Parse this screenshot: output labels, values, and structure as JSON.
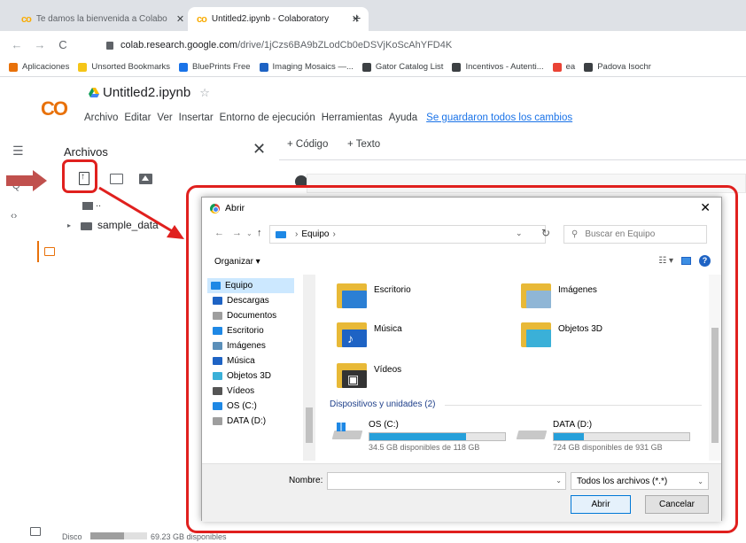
{
  "browser": {
    "tabs": [
      {
        "title": "Te damos la bienvenida a Colabo",
        "active": false
      },
      {
        "title": "Untitled2.ipynb - Colaboratory",
        "active": true
      }
    ],
    "url_host": "colab.research.google.com",
    "url_path": "/drive/1jCzs6BA9bZLodCb0eDSVjKoScAhYFD4K",
    "bookmarks": [
      {
        "label": "Aplicaciones",
        "icon": "apps-grid-icon",
        "color": "#e8710a"
      },
      {
        "label": "Unsorted Bookmarks",
        "icon": "folder-icon",
        "color": "#f5c518"
      },
      {
        "label": "BluePrints Free",
        "icon": "s-logo-icon",
        "color": "#1a73e8"
      },
      {
        "label": "Imaging Mosaics —...",
        "icon": "globe-icon",
        "color": "#1e63c4"
      },
      {
        "label": "Gator Catalog List",
        "icon": "car-icon",
        "color": "#3c4043"
      },
      {
        "label": "Incentivos - Autenti...",
        "icon": "site-icon",
        "color": "#3c4043"
      },
      {
        "label": "ea",
        "icon": "gmail-icon",
        "color": "#ea4335"
      },
      {
        "label": "Padova Isochr",
        "icon": "site-icon",
        "color": "#3c4043"
      }
    ]
  },
  "colab": {
    "logo": "CO",
    "notebook_title": "Untitled2.ipynb",
    "menu": [
      "Archivo",
      "Editar",
      "Ver",
      "Insertar",
      "Entorno de ejecución",
      "Herramientas",
      "Ayuda"
    ],
    "saved_status": "Se guardaron todos los cambios",
    "code_button": "+ Código",
    "text_button": "+ Texto",
    "files_title": "Archivos",
    "tree_up": "..",
    "tree_folder": "sample_data",
    "disk_label": "Disco",
    "disk_free": "69.23 GB disponibles",
    "disk_used_fraction": 0.6
  },
  "dialog": {
    "title": "Abrir",
    "path_root": "Equipo",
    "search_placeholder": "Buscar en Equipo",
    "organize": "Organizar ▾",
    "nav_items": [
      {
        "label": "Equipo",
        "icon": "computer-icon",
        "color": "#1e88e5",
        "selected": true
      },
      {
        "label": "Descargas",
        "icon": "download-icon",
        "color": "#1e63c4",
        "selected": false
      },
      {
        "label": "Documentos",
        "icon": "documents-icon",
        "color": "#9e9e9e",
        "selected": false
      },
      {
        "label": "Escritorio",
        "icon": "desktop-icon",
        "color": "#1e88e5",
        "selected": false
      },
      {
        "label": "Imágenes",
        "icon": "pictures-icon",
        "color": "#5b8fb9",
        "selected": false
      },
      {
        "label": "Música",
        "icon": "music-icon",
        "color": "#1e63c4",
        "selected": false
      },
      {
        "label": "Objetos 3D",
        "icon": "cube-icon",
        "color": "#3ab0d8",
        "selected": false
      },
      {
        "label": "Vídeos",
        "icon": "video-icon",
        "color": "#555555",
        "selected": false
      },
      {
        "label": "OS (C:)",
        "icon": "drive-icon",
        "color": "#1e88e5",
        "selected": false
      },
      {
        "label": "DATA (D:)",
        "icon": "drive-icon",
        "color": "#9e9e9e",
        "selected": false
      }
    ],
    "folders": [
      {
        "label": "Escritorio",
        "icon": "desktop-folder-icon",
        "front": "#2b7fd4"
      },
      {
        "label": "Imágenes",
        "icon": "pictures-folder-icon",
        "front": "#8fb6d6"
      },
      {
        "label": "Música",
        "icon": "music-folder-icon",
        "front": "#1e63c4"
      },
      {
        "label": "Objetos 3D",
        "icon": "objects3d-folder-icon",
        "front": "#3ab0d8"
      },
      {
        "label": "Vídeos",
        "icon": "videos-folder-icon",
        "front": "#333333"
      }
    ],
    "devices_header": "Dispositivos y unidades (2)",
    "drives": [
      {
        "label": "OS (C:)",
        "free_text": "34.5 GB disponibles de 118 GB",
        "used_fraction": 0.71
      },
      {
        "label": "DATA (D:)",
        "free_text": "724 GB disponibles de 931 GB",
        "used_fraction": 0.22
      }
    ],
    "name_label": "Nombre:",
    "name_value": "",
    "file_filter": "Todos los archivos (*.*)",
    "open_button": "Abrir",
    "cancel_button": "Cancelar"
  },
  "annotation_color": "#e0201e"
}
